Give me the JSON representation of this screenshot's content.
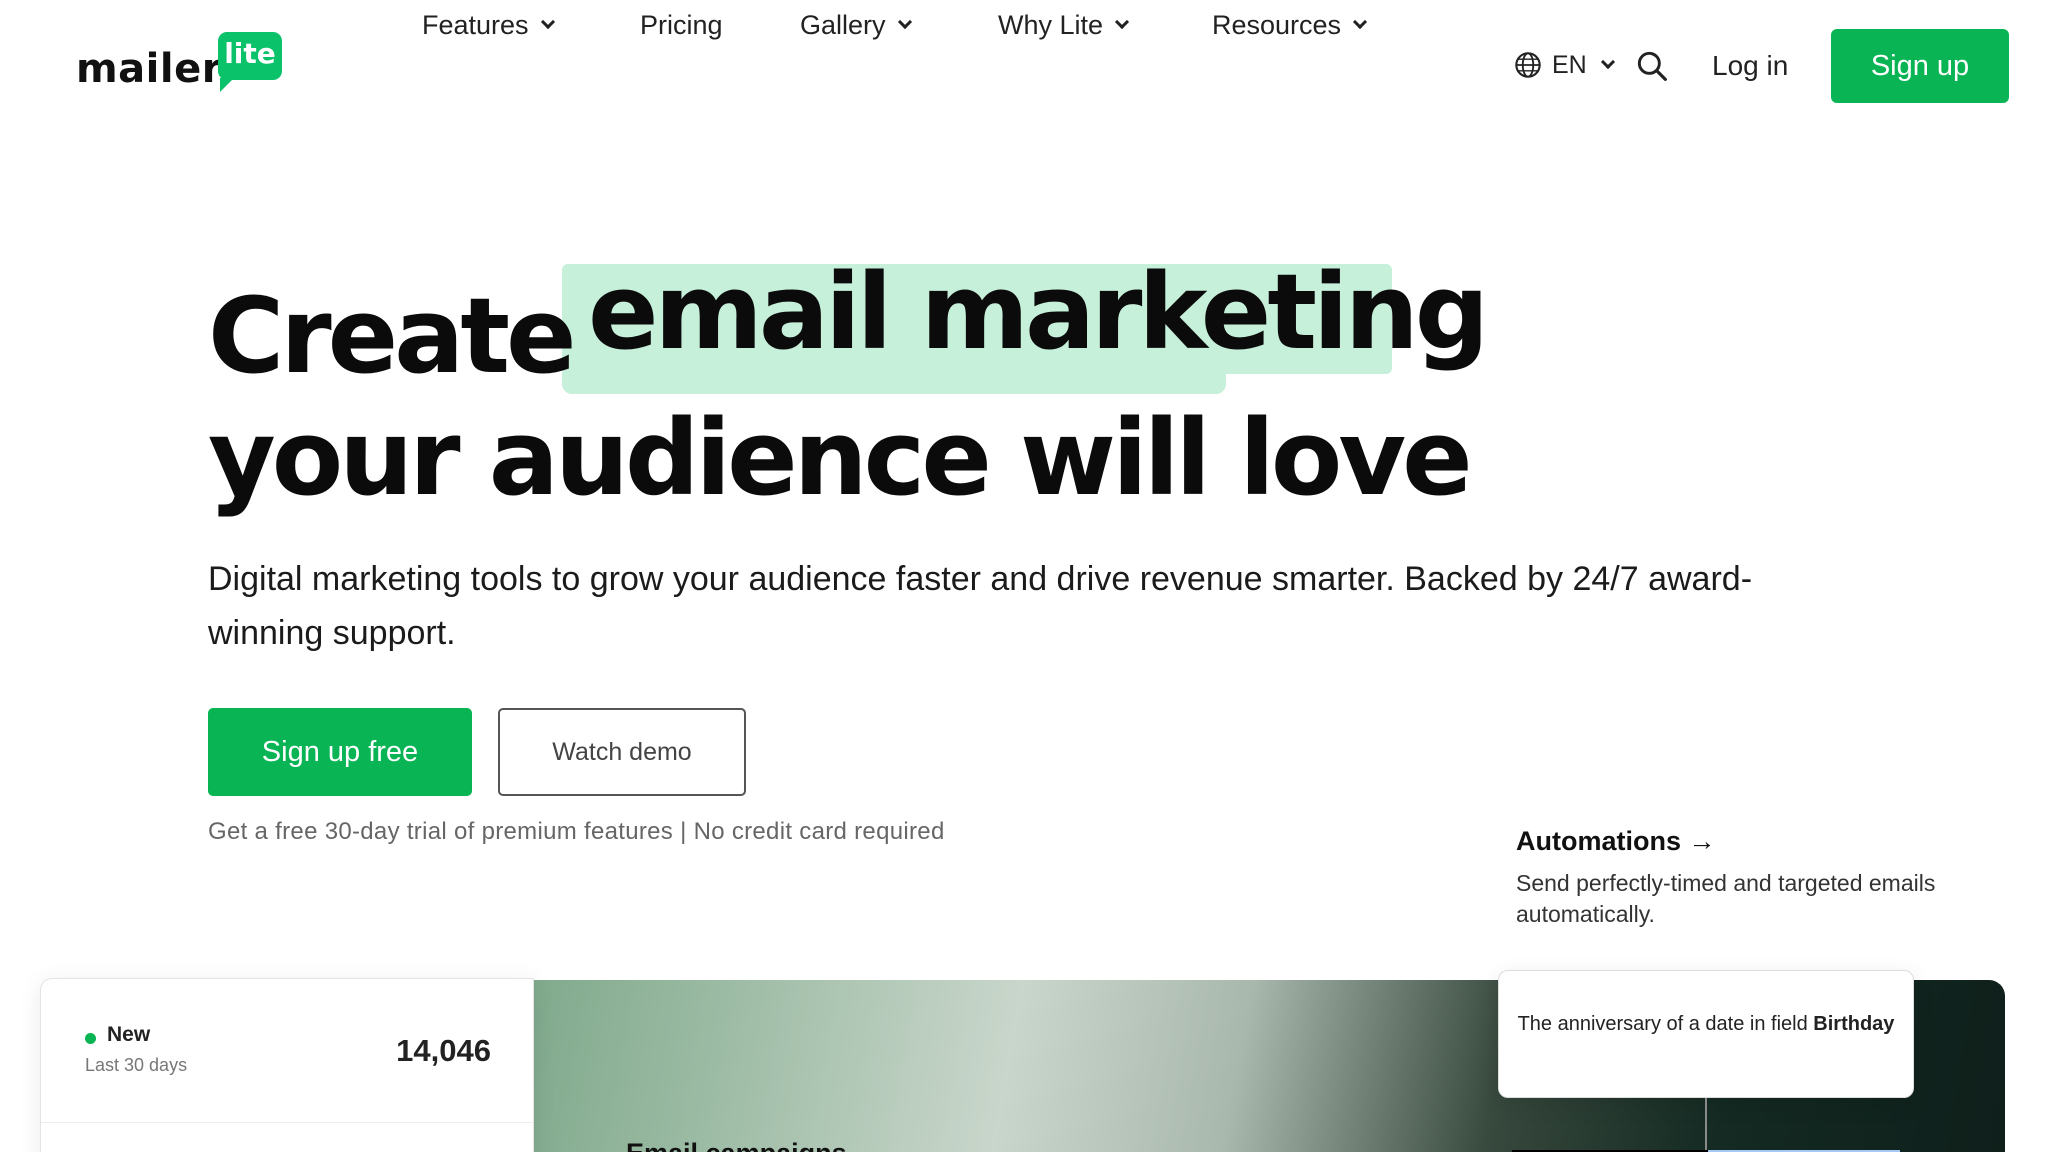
{
  "brand": {
    "word": "mailer",
    "badge": "lite",
    "brand_color": "#09b454",
    "highlight_color": "#c6f0da"
  },
  "nav": {
    "items": [
      {
        "label": "Features",
        "has_dropdown": true
      },
      {
        "label": "Pricing",
        "has_dropdown": false
      },
      {
        "label": "Gallery",
        "has_dropdown": true
      },
      {
        "label": "Why Lite",
        "has_dropdown": true
      },
      {
        "label": "Resources",
        "has_dropdown": true
      }
    ],
    "language": "EN",
    "login": "Log in",
    "signup": "Sign up"
  },
  "hero": {
    "title_part1": "Create",
    "title_highlight": "email marketing",
    "title_part2": "your audience will love",
    "subtitle": "Digital marketing tools to grow your audience faster and drive revenue smarter. Backed by 24/7 award-winning support.",
    "cta_primary": "Sign up free",
    "cta_secondary": "Watch demo",
    "note": "Get a free 30-day trial of premium features | No credit card required"
  },
  "automations": {
    "title": "Automations →",
    "description": "Send perfectly-timed and targeted emails automatically."
  },
  "showcase": {
    "email_campaigns_link": "Email campaigns →",
    "stats": {
      "label": "New",
      "sublabel": "Last 30 days",
      "value": "14,046"
    },
    "trigger": {
      "text": "The anniversary of a date in field",
      "field": "Birthday"
    }
  }
}
